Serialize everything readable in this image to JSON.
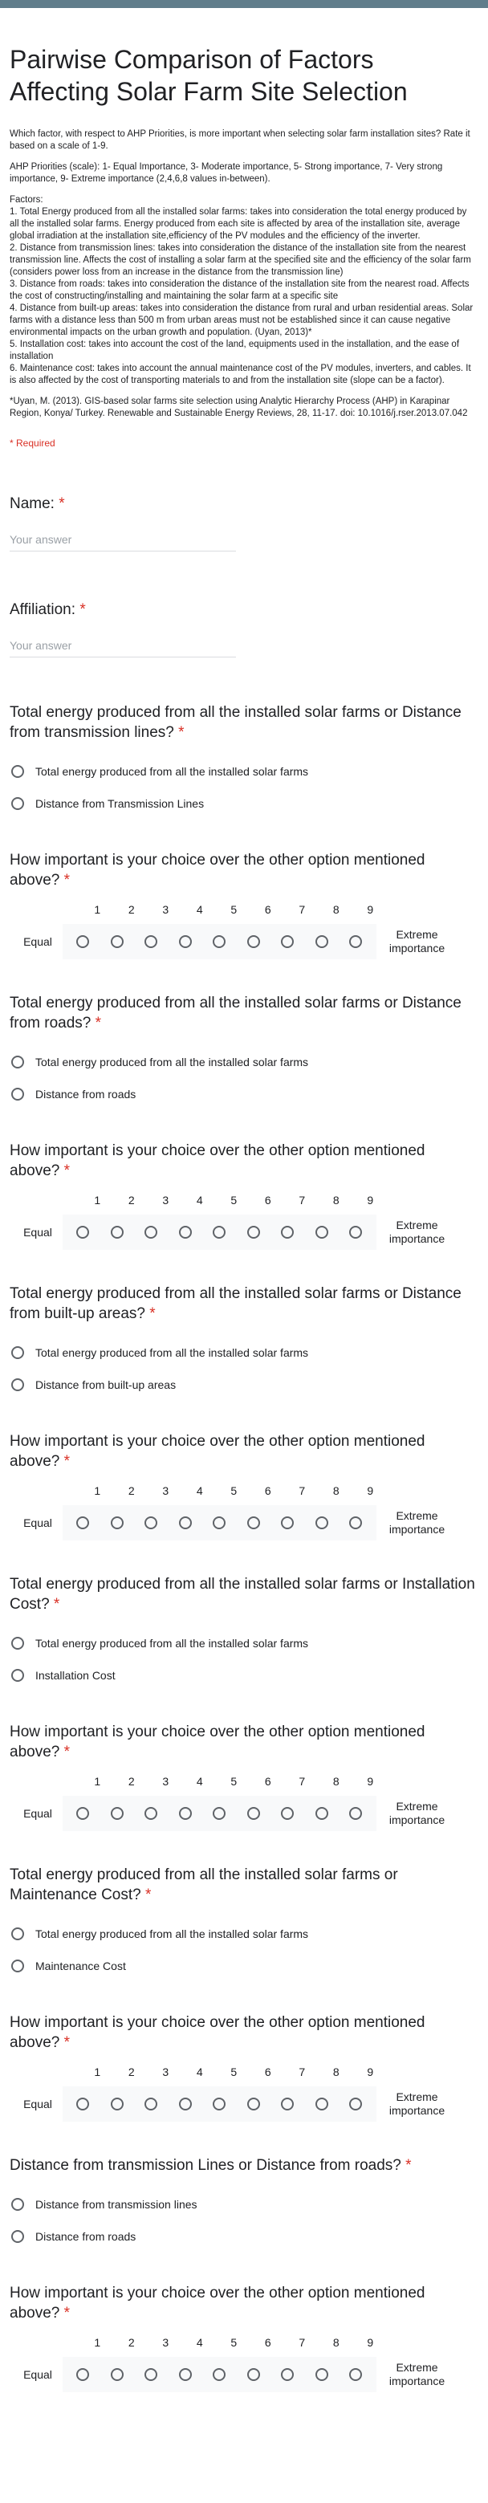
{
  "form": {
    "title": "Pairwise Comparison of Factors Affecting Solar Farm Site Selection",
    "intro": "Which factor, with respect to AHP Priorities, is more important when selecting solar farm installation sites? Rate it based on a scale of 1-9.",
    "priorities": "AHP Priorities (scale):  1- Equal Importance, 3- Moderate importance, 5- Strong importance, 7- Very strong importance, 9- Extreme importance (2,4,6,8 values in-between).",
    "factors_heading": "Factors:",
    "factors": [
      "1. Total Energy produced from all the installed solar farms: takes into consideration the total energy produced by all the installed solar farms. Energy produced from each site is affected by area of the installation site, average global irradiation at the installation site,efficiency of the PV modules and the efficiency of the inverter.",
      "2. Distance from transmission lines: takes into consideration the distance of the installation site from the nearest transmission line. Affects the cost of installing a solar farm at the specified site and the efficiency of the solar farm (considers power loss from an increase in the distance from the transmission line)",
      "3. Distance from roads: takes into consideration the distance of the installation site from the nearest road. Affects the cost of constructing/installing and maintaining the solar farm at a specific site",
      "4. Distance from built-up areas: takes into consideration the distance from rural and urban residential areas. Solar farms with a distance less than 500 m from urban areas must not be established since it can cause negative environmental impacts on the urban growth and population. (Uyan, 2013)*",
      "5. Installation cost: takes into account the cost of the land, equipments used in the installation, and the ease of installation",
      "6. Maintenance cost: takes into account the annual maintenance cost of the PV modules, inverters, and cables. It is also affected by the cost of transporting materials to and from the installation site (slope can be a factor)."
    ],
    "citation": "*Uyan, M. (2013). GIS-based solar farms site selection using Analytic Hierarchy Process (AHP) in Karapinar Region, Konya/ Turkey. Renewable and Sustainable Energy Reviews, 28, 11-17. doi: 10.1016/j.rser.2013.07.042",
    "required_note": "* Required"
  },
  "name_q": {
    "label": "Name: ",
    "placeholder": "Your answer"
  },
  "affiliation_q": {
    "label": "Affiliation: ",
    "placeholder": "Your answer"
  },
  "star": "*",
  "scale": {
    "numbers": [
      "1",
      "2",
      "3",
      "4",
      "5",
      "6",
      "7",
      "8",
      "9"
    ],
    "left": "Equal",
    "right": "Extreme importance",
    "question": "How important is your choice over the other option mentioned above? "
  },
  "comparisons": [
    {
      "question": "Total energy produced from all the installed solar farms or Distance from transmission lines? ",
      "a": "Total energy produced from all the installed solar farms",
      "b": "Distance from Transmission Lines"
    },
    {
      "question": "Total energy produced from all the installed solar farms or Distance from roads? ",
      "a": "Total energy produced from all the installed solar farms",
      "b": "Distance from roads"
    },
    {
      "question": "Total energy produced from all the installed solar farms or Distance from built-up areas? ",
      "a": "Total energy produced from all the installed solar farms",
      "b": "Distance from built-up areas"
    },
    {
      "question": "Total energy produced from all the installed solar farms or Installation Cost? ",
      "a": "Total energy produced from all the installed solar farms",
      "b": "Installation Cost"
    },
    {
      "question": "Total energy produced from all the installed solar farms or Maintenance Cost? ",
      "a": "Total energy produced from all the installed solar farms",
      "b": "Maintenance Cost"
    },
    {
      "question": "Distance from transmission Lines or Distance from roads? ",
      "a": "Distance from transmission lines",
      "b": "Distance from roads"
    }
  ]
}
